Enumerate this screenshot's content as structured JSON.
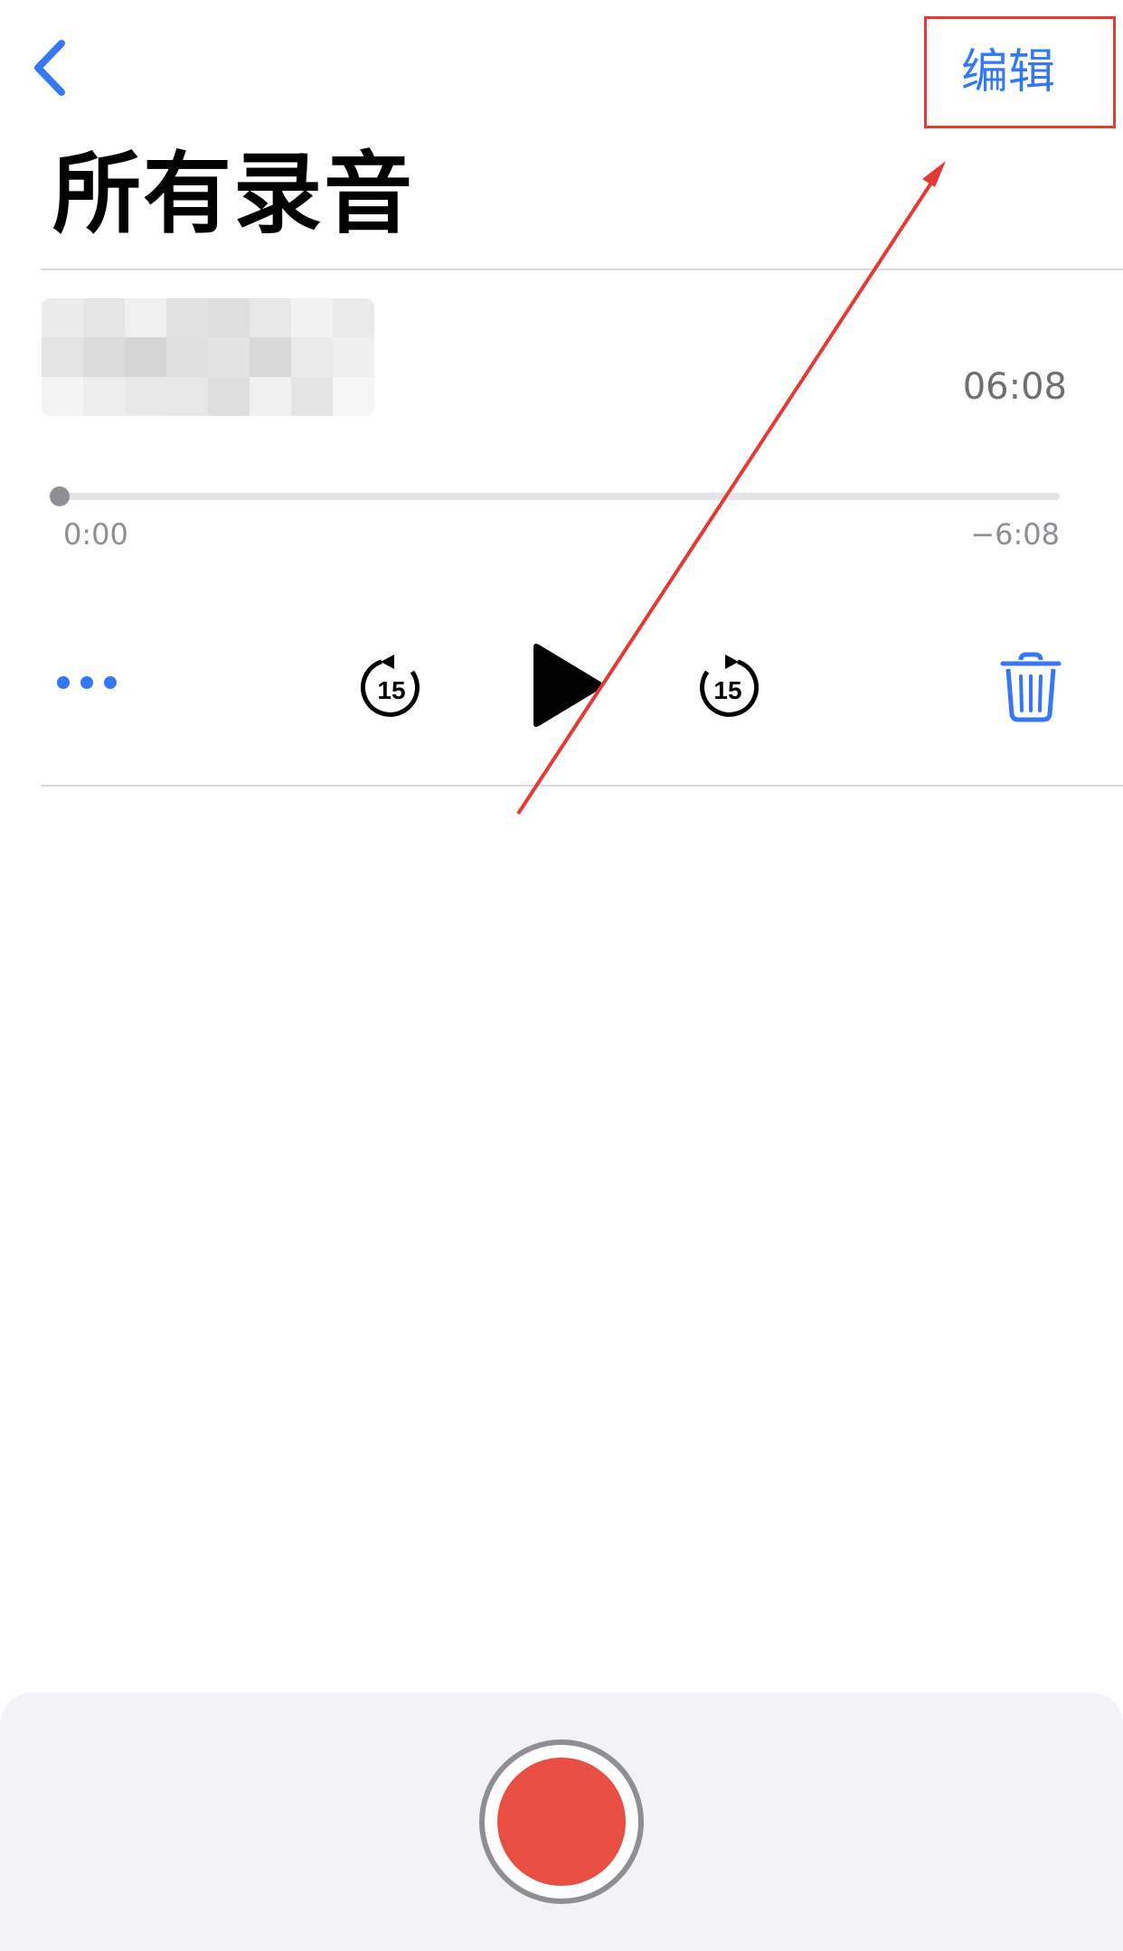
{
  "nav": {
    "back_icon": "chevron-left-icon",
    "edit_label": "编辑"
  },
  "title": "所有录音",
  "recording": {
    "name_redacted": true,
    "duration": "06:08",
    "progress": 0.0,
    "elapsed": "0:00",
    "remaining": "−6:08"
  },
  "controls": {
    "more_icon": "ellipsis-icon",
    "skip_back_icon": "skip-back-15-icon",
    "skip_back_seconds": "15",
    "play_icon": "play-icon",
    "skip_forward_icon": "skip-forward-15-icon",
    "skip_forward_seconds": "15",
    "delete_icon": "trash-icon"
  },
  "record_bar": {
    "record_icon": "record-icon"
  },
  "colors": {
    "accent": "#3478f6",
    "record": "#e94e43",
    "annotation": "#e53935",
    "secondary_text": "#6e6e73",
    "record_bar_bg": "#f2f2f7"
  }
}
